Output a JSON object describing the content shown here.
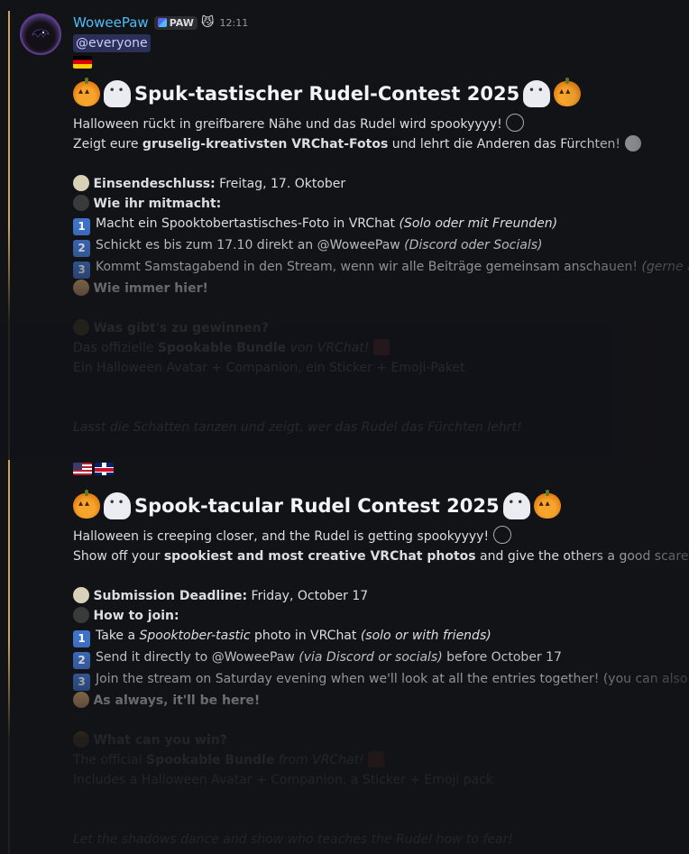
{
  "header": {
    "username": "WoweePaw",
    "tag": "PAW",
    "time": "12:11",
    "mention": "@everyone"
  },
  "de": {
    "title": "Spuk-tastischer Rudel-Contest 2025",
    "l1": "Halloween rückt in greifbarere Nähe und das Rudel wird spookyyyy!",
    "l2a": "Zeigt eure ",
    "l2b": "gruselig-kreativsten VRChat-Fotos",
    "l2c": " und lehrt die Anderen das Fürchten!",
    "deadline_label": "Einsendeschluss:",
    "deadline_value": " Freitag, 17. Oktober",
    "how_label": "Wie ihr mitmacht:",
    "s1a": "Macht ein Spooktobertastisches-Foto in VRChat ",
    "s1b": "(Solo oder mit Freunden)",
    "s2a": "Schickt es bis zum 17.10 direkt an ",
    "s2m": "@WoweePaw",
    "s2b": " (Discord oder Socials)",
    "s3a": "Kommt Samstagabend in den Stream, wenn wir alle Beiträge gemeinsam anschauen! ",
    "s3b": "(gerne auch",
    "always": "Wie immer hier!",
    "prize_label": "Was gibt's zu gewinnen?",
    "prize1a": "Das offizielle ",
    "prize1b": "Spookable Bundle",
    "prize1c": " von VRChat!",
    "prize2": "Ein Halloween Avatar + Companion, ein Sticker + Emoji-Paket",
    "closing": "Lasst die Schatten tanzen und zeigt, wer das Rudel das Fürchten lehrt!"
  },
  "en": {
    "title": "Spook-tacular Rudel Contest 2025",
    "l1": "Halloween is creeping closer, and the Rudel is getting spookyyyy!",
    "l2a": "Show off your ",
    "l2b": "spookiest and most creative VRChat photos",
    "l2c": " and give the others a good scare!",
    "deadline_label": "Submission Deadline:",
    "deadline_value": " Friday, October 17",
    "how_label": "How to join:",
    "s1a": "Take a ",
    "s1b": "Spooktober-tastic",
    "s1c": " photo in VRChat ",
    "s1d": "(solo or with friends)",
    "s2a": "Send it directly to ",
    "s2m": "@WoweePaw",
    "s2b": " (via Discord or socials)",
    "s2c": " before October 17",
    "s3a": "Join the stream on Saturday evening when we'll look at all the entries together! (you can also",
    "always": "As always, it'll be here!",
    "prize_label": "What can you win?",
    "prize1a": "The official ",
    "prize1b": "Spookable Bundle",
    "prize1c": " from VRChat!",
    "prize2": "Includes a Halloween Avatar + Companion, a Sticker + Emoji pack",
    "closing": "Let the shadows dance and show who teaches the Rudel how to fear!"
  },
  "icons": [
    "avatar-ghost",
    "pumpkin",
    "ghost",
    "spider-web",
    "skull",
    "clock",
    "bomb",
    "keycap-1",
    "keycap-2",
    "keycap-3",
    "pointing-hand",
    "trophy",
    "gift",
    "flag-de",
    "flag-us",
    "flag-uk"
  ],
  "colors": {
    "username": "#4ebdf6",
    "side_bar": "#c9a35a",
    "mention_bg": "#2c2f57",
    "keycap": "#3e72c7"
  }
}
